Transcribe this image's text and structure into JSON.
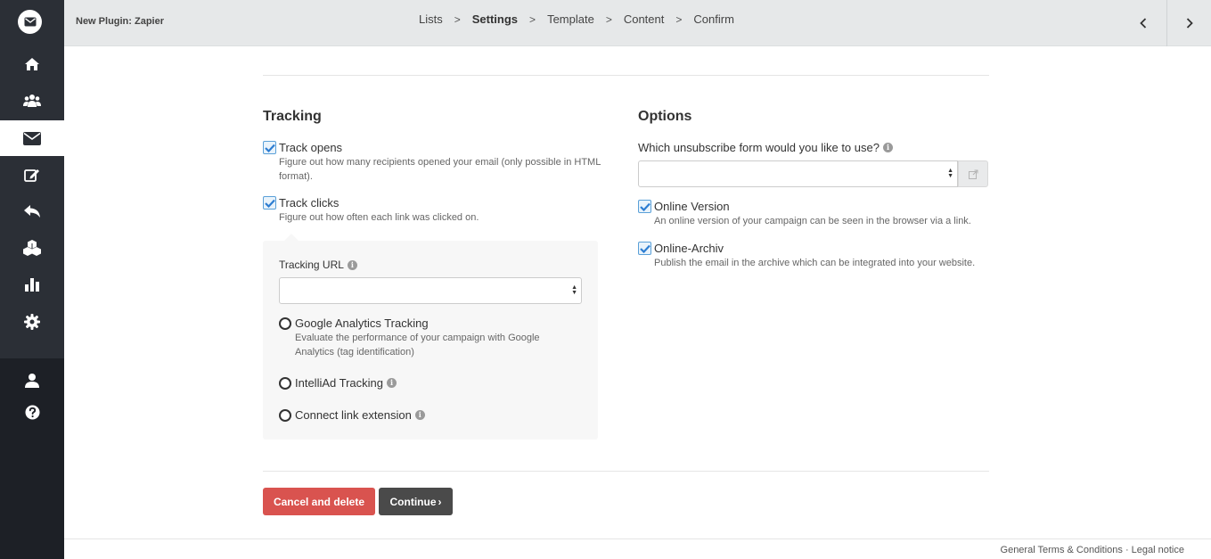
{
  "header": {
    "title": "New Plugin: Zapier",
    "steps": [
      {
        "label": "Lists"
      },
      {
        "label": "Settings"
      },
      {
        "label": "Template"
      },
      {
        "label": "Content"
      },
      {
        "label": "Confirm"
      }
    ],
    "current_step": "Settings",
    "separator": ">"
  },
  "sidebar": {
    "items": [
      "home-icon",
      "users-icon",
      "envelope-icon",
      "edit-icon",
      "reply-icon",
      "cubes-icon",
      "bar-chart-icon",
      "gear-icon"
    ],
    "bottom_items": [
      "user-icon",
      "help-icon"
    ],
    "active_item": "envelope-icon"
  },
  "tracking": {
    "title": "Tracking",
    "track_opens": {
      "label": "Track opens",
      "help_line1": "Figure out how many recipients opened your email (only possible in HTML",
      "help_line2": "format).",
      "checked": true
    },
    "track_clicks": {
      "label": "Track clicks",
      "help": "Figure out how often each link was clicked on.",
      "checked": true
    },
    "tracking_url": {
      "label": "Tracking URL",
      "value": ""
    },
    "google_analytics": {
      "label": "Google Analytics Tracking",
      "help_line1": "Evaluate the performance of your campaign with Google",
      "help_line2": "Analytics (tag identification)"
    },
    "intelliad": {
      "label": "IntelliAd Tracking"
    },
    "connect_link": {
      "label": "Connect link extension"
    }
  },
  "options": {
    "title": "Options",
    "unsubscribe_label": "Which unsubscribe form would you like to use?",
    "unsubscribe_value": "",
    "online_version": {
      "label": "Online Version",
      "help": "An online version of your campaign can be seen in the browser via a link.",
      "checked": true
    },
    "online_archiv": {
      "label": "Online-Archiv",
      "help": "Publish the email in the archive which can be integrated into your website.",
      "checked": true
    }
  },
  "buttons": {
    "cancel_label": "Cancel and delete",
    "continue_label": "Continue",
    "continue_suffix": "›"
  },
  "footer": {
    "terms": "General Terms & Conditions",
    "separator": " · ",
    "legal": "Legal notice"
  },
  "colors": {
    "sidebar": "#2b2f36",
    "danger": "#d9534f",
    "dark_button": "#4a4a4a",
    "checkbox_accent": "#2d7dd2"
  }
}
